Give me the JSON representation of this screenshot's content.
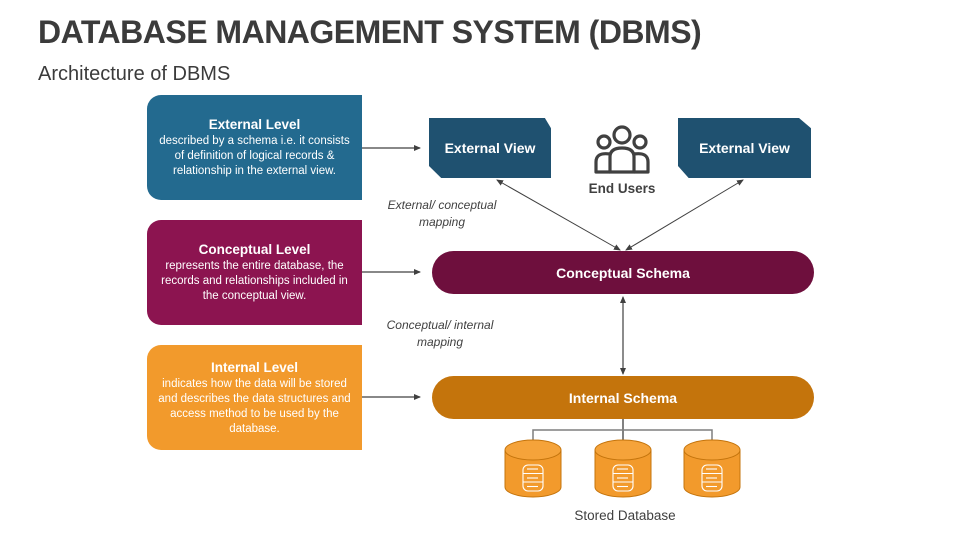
{
  "header": {
    "title": "DATABASE MANAGEMENT SYSTEM (DBMS)",
    "subtitle": "Architecture of DBMS"
  },
  "levels": [
    {
      "heading": "External Level",
      "description": "described by a schema i.e. it consists of definition of logical records & relationship in the external view.",
      "color": "#236a8f"
    },
    {
      "heading": "Conceptual Level",
      "description": "represents the entire database, the records and relationships included in the conceptual view.",
      "color": "#8c1450"
    },
    {
      "heading": "Internal Level",
      "description": "indicates how the data will be stored and describes the data structures and access method to be used by the database.",
      "color": "#f29a2c"
    }
  ],
  "diagram": {
    "external_views": [
      "External View",
      "External View"
    ],
    "end_users_label": "End Users",
    "end_users_icon": "users-icon",
    "conceptual_schema": "Conceptual Schema",
    "internal_schema": "Internal Schema",
    "mapping_external_conceptual": "External/ conceptual mapping",
    "mapping_conceptual_internal": "Conceptual/ internal mapping",
    "stored_database_label": "Stored Database",
    "database_icon": "database-cylinder-icon",
    "database_count": 3,
    "colors": {
      "external_view": "#1f5170",
      "conceptual_schema": "#6e0f3d",
      "internal_schema": "#c4740c",
      "database": "#f29a2c"
    }
  }
}
